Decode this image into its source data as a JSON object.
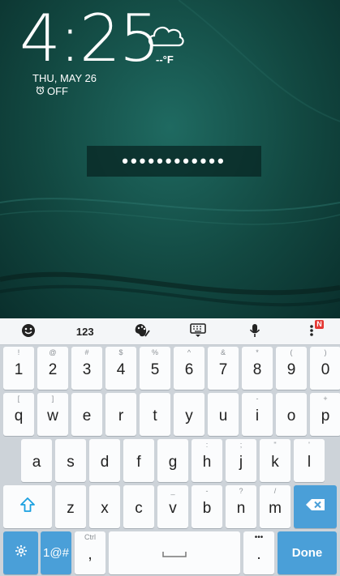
{
  "lock": {
    "time": "4:25",
    "temperature": "--°F",
    "date": "THU, MAY 26",
    "alarm": "OFF",
    "password_mask": "••••••••••••"
  },
  "toolbar": {
    "number_label": "123",
    "notification_badge": "N",
    "icons": [
      "emoji-icon",
      "numbers",
      "theme-palette-icon",
      "keyboard-icon",
      "microphone-icon",
      "more-icon"
    ]
  },
  "rows": {
    "numbers": [
      {
        "label": "1",
        "hint": "!"
      },
      {
        "label": "2",
        "hint": "@"
      },
      {
        "label": "3",
        "hint": "#"
      },
      {
        "label": "4",
        "hint": "$"
      },
      {
        "label": "5",
        "hint": "%"
      },
      {
        "label": "6",
        "hint": "^"
      },
      {
        "label": "7",
        "hint": "&"
      },
      {
        "label": "8",
        "hint": "*"
      },
      {
        "label": "9",
        "hint": "("
      },
      {
        "label": "0",
        "hint": ")"
      }
    ],
    "top": [
      {
        "label": "q",
        "hint": "["
      },
      {
        "label": "w",
        "hint": "]"
      },
      {
        "label": "e",
        "hint": ""
      },
      {
        "label": "r",
        "hint": ""
      },
      {
        "label": "t",
        "hint": ""
      },
      {
        "label": "y",
        "hint": ""
      },
      {
        "label": "u",
        "hint": ""
      },
      {
        "label": "i",
        "hint": "-"
      },
      {
        "label": "o",
        "hint": ""
      },
      {
        "label": "p",
        "hint": "+"
      }
    ],
    "home": [
      {
        "label": "a",
        "hint": ""
      },
      {
        "label": "s",
        "hint": ""
      },
      {
        "label": "d",
        "hint": ""
      },
      {
        "label": "f",
        "hint": ""
      },
      {
        "label": "g",
        "hint": ""
      },
      {
        "label": "h",
        "hint": ":"
      },
      {
        "label": "j",
        "hint": ";"
      },
      {
        "label": "k",
        "hint": "\""
      },
      {
        "label": "l",
        "hint": "'"
      }
    ],
    "bottom": [
      {
        "label": "z",
        "hint": ""
      },
      {
        "label": "x",
        "hint": ""
      },
      {
        "label": "c",
        "hint": ""
      },
      {
        "label": "v",
        "hint": "_"
      },
      {
        "label": "b",
        "hint": "-"
      },
      {
        "label": "n",
        "hint": "?"
      },
      {
        "label": "m",
        "hint": "/"
      }
    ],
    "function": {
      "symbols_label": "1@#",
      "comma_label": ",",
      "comma_hint": "Ctrl",
      "period_label": ".",
      "period_hint": "•••",
      "done_label": "Done"
    }
  },
  "colors": {
    "accent": "#4a9fd8",
    "keyboard_bg": "#cdd3d9",
    "badge": "#e53935"
  }
}
